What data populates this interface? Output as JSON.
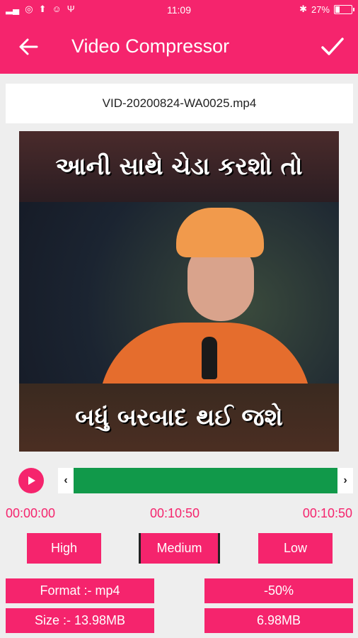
{
  "status_bar": {
    "time": "11:09",
    "battery": "27%",
    "battery_level": 0.27,
    "left_icons": [
      "signal-icon",
      "wifi-icon",
      "instagram-icon",
      "upload-icon",
      "cat-icon",
      "usb-icon"
    ],
    "right_icons": [
      "bluetooth-icon",
      "battery-icon"
    ]
  },
  "app_bar": {
    "title": "Video Compressor",
    "back_icon": "arrow-left-icon",
    "confirm_icon": "check-icon"
  },
  "file": {
    "name": "VID-20200824-WA0025.mp4"
  },
  "video": {
    "caption_top": "આની સાથે ચેડા કરશો તો",
    "caption_bottom": "બધું બરબાદ થઈ જશે"
  },
  "player": {
    "play_icon": "play-icon",
    "trim_left": "‹",
    "trim_right": "›",
    "start_time": "00:00:00",
    "mid_time": "00:10:50",
    "end_time": "00:10:50"
  },
  "quality": {
    "options": [
      "High",
      "Medium",
      "Low"
    ],
    "selected": "Medium"
  },
  "info": {
    "format": "Format :- mp4",
    "reduction": "-50%",
    "size": "Size :- 13.98MB",
    "new_size": "6.98MB"
  },
  "colors": {
    "accent": "#f5246d",
    "trim_selected": "#11994a"
  }
}
